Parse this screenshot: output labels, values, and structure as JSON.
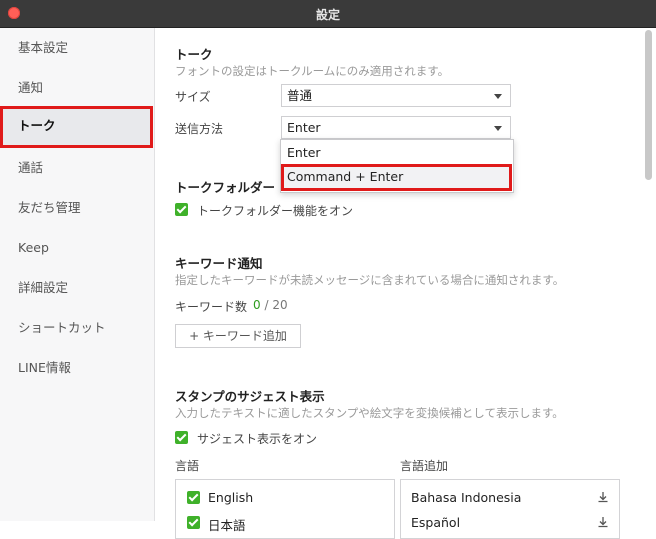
{
  "window": {
    "title": "設定"
  },
  "sidebar": {
    "items": [
      {
        "label": "基本設定"
      },
      {
        "label": "通知"
      },
      {
        "label": "トーク"
      },
      {
        "label": "通話"
      },
      {
        "label": "友だち管理"
      },
      {
        "label": "Keep"
      },
      {
        "label": "詳細設定"
      },
      {
        "label": "ショートカット"
      },
      {
        "label": "LINE情報"
      }
    ],
    "active_index": 2
  },
  "talk": {
    "heading": "トーク",
    "description": "フォントの設定はトークルームにのみ適用されます。",
    "size_label": "サイズ",
    "size_value": "普通",
    "send_label": "送信方法",
    "send_value": "Enter",
    "send_options": [
      "Enter",
      "Command + Enter"
    ],
    "highlighted_option": "Command + Enter"
  },
  "talk_folder": {
    "heading": "トークフォルダー",
    "checkbox_label": "トークフォルダー機能をオン",
    "checked": true
  },
  "keyword": {
    "heading": "キーワード通知",
    "description": "指定したキーワードが未読メッセージに含まれている場合に通知されます。",
    "count_label": "キーワード数",
    "count_current": "0",
    "count_max": "/ 20",
    "add_button": "+ キーワード追加"
  },
  "sticker": {
    "heading": "スタンプのサジェスト表示",
    "description": "入力したテキストに適したスタンプや絵文字を変換候補として表示します。",
    "checkbox_label": "サジェスト表示をオン",
    "checked": true,
    "languages_header": "言語",
    "languages": [
      "English",
      "日本語"
    ],
    "add_languages_header": "言語追加",
    "add_languages": [
      "Bahasa Indonesia",
      "Español"
    ]
  },
  "colors": {
    "accent_green": "#3fb12a",
    "highlight_red": "#e01a1a"
  }
}
